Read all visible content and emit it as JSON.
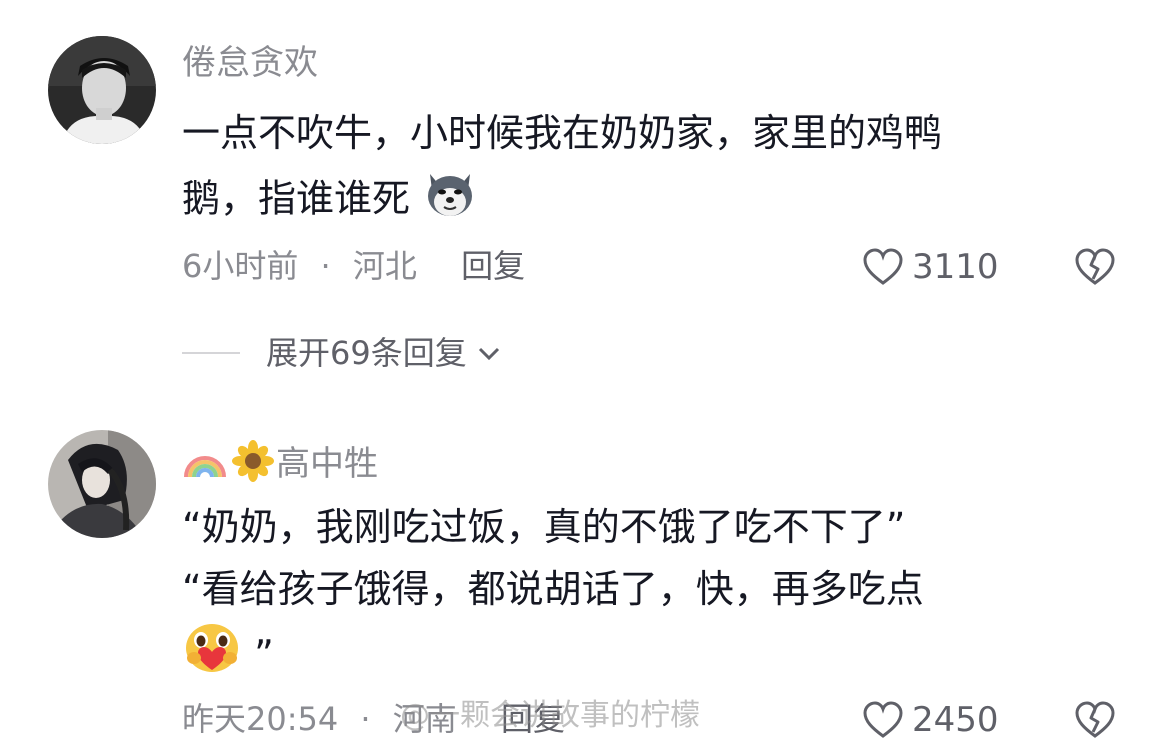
{
  "comments": [
    {
      "username": "倦怠贪欢",
      "text_line1": "一点不吹牛，小时候我在奶奶家，家里的鸡鸭",
      "text_line2": "鹅，指谁谁死",
      "emoji": "dog-emoji",
      "time": "6小时前",
      "separator": "·",
      "location": "河北",
      "reply_label": "回复",
      "likes": "3110",
      "expand_label": "展开69条回复"
    },
    {
      "username": "高中牲",
      "name_emojis": [
        "rainbow-emoji",
        "sunflower-emoji"
      ],
      "text_line1": "“奶奶，我刚吃过饭，真的不饿了吃不下了”",
      "text_line2": "“看给孩子饿得，都说胡话了，快，再多吃点",
      "text_line3_suffix": "”",
      "emoji": "heart-hug-emoji",
      "time": "昨天20:54",
      "separator": "·",
      "location": "河南",
      "reply_label": "回复",
      "likes": "2450"
    }
  ],
  "watermark": "@一颗会讲故事的柠檬",
  "colors": {
    "primary_text": "#161823",
    "secondary_text": "#8a8b91",
    "icon": "#5f6068"
  }
}
